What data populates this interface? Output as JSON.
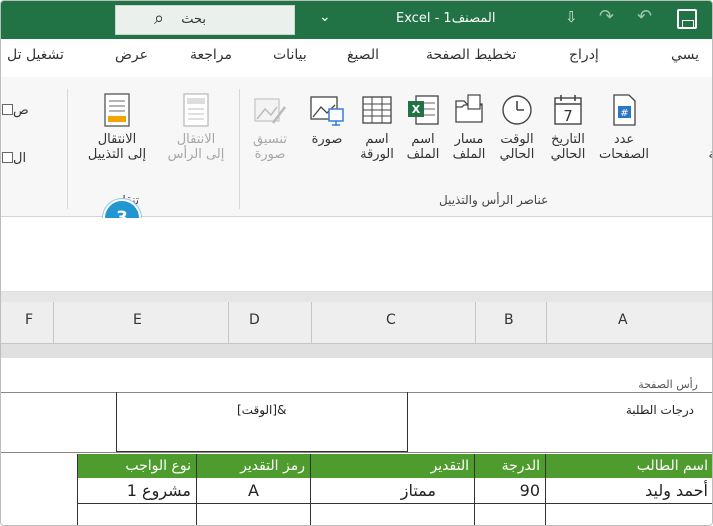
{
  "titlebar": {
    "search_label": "بحث",
    "window_title": "Excel - المصنف1"
  },
  "tabs": [
    {
      "label": "تشغيل تل"
    },
    {
      "label": "عرض"
    },
    {
      "label": "مراجعة"
    },
    {
      "label": "بيانات"
    },
    {
      "label": "الصيغ"
    },
    {
      "label": "تخطيط الصفحة"
    },
    {
      "label": "إدراج"
    },
    {
      "label": "يسي"
    }
  ],
  "ribbon": {
    "buttons": [
      {
        "line1": "عدد",
        "line2": "الصفحات"
      },
      {
        "line1": "التاريخ",
        "line2": "الحالي"
      },
      {
        "line1": "الوقت",
        "line2": "الحالي"
      },
      {
        "line1": "مسار",
        "line2": "الملف"
      },
      {
        "line1": "اسم",
        "line2": "الملف"
      },
      {
        "line1": "اسم",
        "line2": "الورقة"
      },
      {
        "line1": "صورة",
        "line2": ""
      },
      {
        "line1": "تنسيق",
        "line2": "صورة"
      },
      {
        "line1": "الانتقال",
        "line2": "إلى الرأس"
      },
      {
        "line1": "الانتقال",
        "line2": "إلى التذييل"
      }
    ],
    "partial_left": "حة",
    "group_header_footer": "عناصر الرأس والتذييل",
    "group_nav": "تنقل",
    "checkboxes": [
      {
        "label": "ص"
      },
      {
        "label": "ال"
      }
    ]
  },
  "step_badge": "3",
  "columns": [
    "A",
    "B",
    "C",
    "D",
    "E",
    "F"
  ],
  "page": {
    "header_label": "رأس الصفحة",
    "left_section": "درجات الطلبة",
    "center_section": "&[الوقت]"
  },
  "table": {
    "headers": [
      "اسم الطالب",
      "الدرجة",
      "التقدير",
      "رمز التقدير",
      "نوع الواجب"
    ],
    "rows": [
      [
        "أحمد وليد",
        "90",
        "ممتاز",
        "A",
        "مشروع 1"
      ]
    ]
  }
}
